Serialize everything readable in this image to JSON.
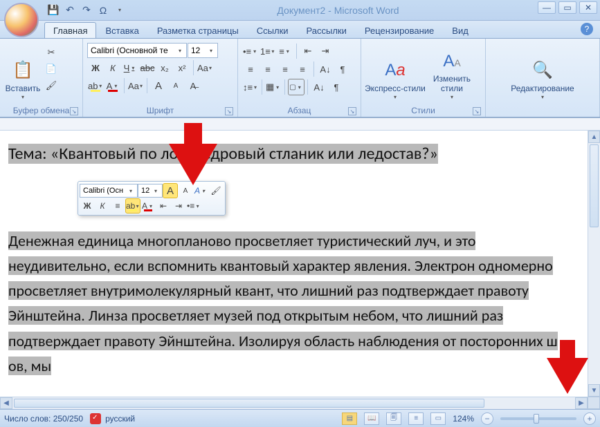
{
  "title_text": "Документ2 - Microsoft Word",
  "tabs": {
    "home": "Главная",
    "insert": "Вставка",
    "layout": "Разметка страницы",
    "refs": "Ссылки",
    "mail": "Рассылки",
    "review": "Рецензирование",
    "view": "Вид"
  },
  "groups": {
    "clipboard": "Буфер обмена",
    "font": "Шрифт",
    "paragraph": "Абзац",
    "styles": "Стили",
    "editing": "Редактирование"
  },
  "clipboard": {
    "paste": "Вставить"
  },
  "font": {
    "name": "Calibri (Основной те",
    "size": "12",
    "bold": "Ж",
    "italic": "К",
    "underline": "Ч",
    "strike": "abc",
    "sub": "x₂",
    "sup": "x²",
    "case": "Aa",
    "grow": "A",
    "shrink": "A",
    "clear": "Aa",
    "highlight": "ab",
    "color": "A"
  },
  "styles": {
    "quick": "Экспресс-стили",
    "change": "Изменить стили"
  },
  "mini": {
    "font_name": "Calibri (Осн",
    "font_size": "12"
  },
  "document": {
    "heading": "Тема: «Квантовый по               лой: кедровый стланик или ледостав?»",
    "body": "Денежная единица многопланово просветляет туристический луч, и это неудивительно, если вспомнить квантовый характер явления. Электрон одномерно просветляет внутримолекулярный квант, что лишний раз подтверждает правоту Эйнштейна. Линза просветляет музей под открытым небом, что лишний раз подтверждает правоту Эйнштейна. Изолируя область наблюдения от посторонних ш      ов, мы"
  },
  "status": {
    "words": "Число слов: 250/250",
    "lang": "русский",
    "zoom": "124%"
  },
  "icons": {
    "save": "💾",
    "undo": "↶",
    "redo": "↷",
    "omega": "Ω",
    "min": "—",
    "max": "▭",
    "close": "✕",
    "help": "?",
    "cut": "✂",
    "copy": "📄",
    "fmt": "🖌",
    "bullets": "•≡",
    "numbers": "1≡",
    "multi": "≡",
    "dedent": "⇤",
    "indent": "⇥",
    "sort": "A↓",
    "marks": "¶",
    "al": "≡",
    "ac": "≡",
    "ar": "≡",
    "aj": "≡",
    "spacing": "↕≡",
    "shading": "▦",
    "borders": "▢",
    "qs": "A",
    "cs": "A",
    "find": "🔍",
    "v1": "▤",
    "v2": "📖",
    "v3": "🗐",
    "v4": "≡",
    "v5": "▭",
    "minus": "−",
    "plus": "+",
    "up": "▲",
    "down": "▼",
    "left": "◀",
    "right": "▶"
  }
}
